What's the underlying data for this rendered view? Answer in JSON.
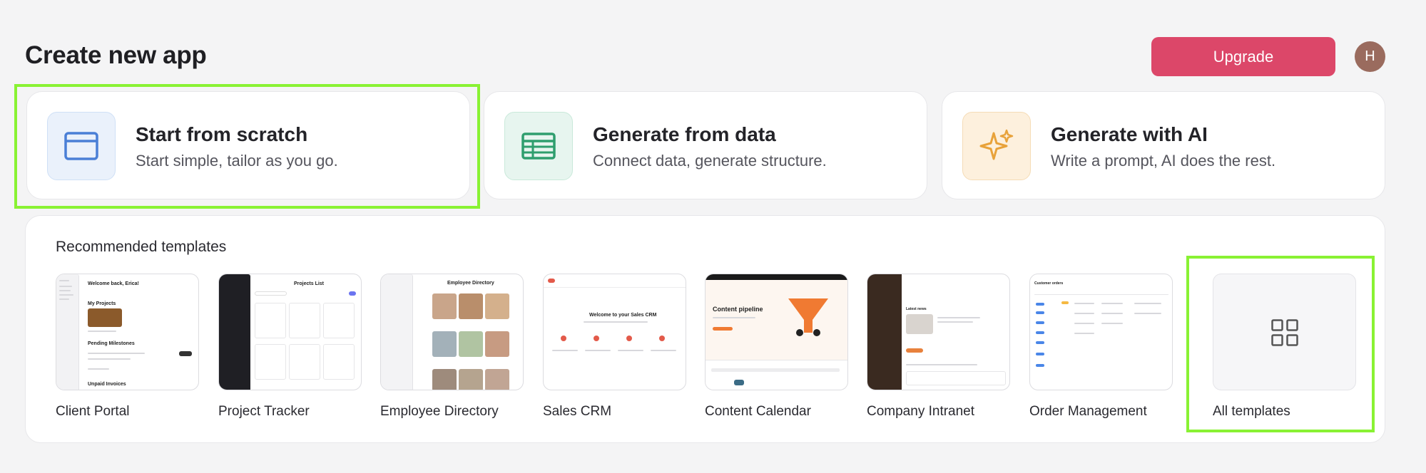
{
  "header": {
    "title": "Create new app",
    "upgrade_label": "Upgrade",
    "avatar_initial": "H"
  },
  "options": [
    {
      "title": "Start from scratch",
      "subtitle": "Start simple, tailor as you go.",
      "icon": "browser-window-icon",
      "icon_color": "#4a7fd6",
      "bg": "#eaf1fb"
    },
    {
      "title": "Generate from data",
      "subtitle": "Connect data, generate structure.",
      "icon": "table-grid-icon",
      "icon_color": "#2f9e6e",
      "bg": "#e7f5ef"
    },
    {
      "title": "Generate with AI",
      "subtitle": "Write a prompt, AI does the rest.",
      "icon": "sparkles-icon",
      "icon_color": "#e8a23a",
      "bg": "#fdf0dd"
    }
  ],
  "templates": {
    "title": "Recommended templates",
    "items": [
      {
        "name": "Client Portal",
        "preview": {
          "heading": "Welcome back, Erica!",
          "section1": "My Projects",
          "section2": "Pending Milestones",
          "section3": "Unpaid Invoices"
        }
      },
      {
        "name": "Project Tracker",
        "preview": {
          "heading": "Projects List"
        }
      },
      {
        "name": "Employee Directory",
        "preview": {
          "heading": "Employee Directory"
        }
      },
      {
        "name": "Sales CRM",
        "preview": {
          "heading": "Welcome to your Sales CRM"
        }
      },
      {
        "name": "Content Calendar",
        "preview": {
          "heading": "Content pipeline"
        }
      },
      {
        "name": "Company Intranet",
        "preview": {
          "heading": "Latest news"
        }
      },
      {
        "name": "Order Management",
        "preview": {
          "heading": "Customer orders"
        }
      }
    ],
    "all_label": "All templates"
  },
  "accent": {
    "upgrade": "#dc4769",
    "highlight": "#89f233"
  }
}
